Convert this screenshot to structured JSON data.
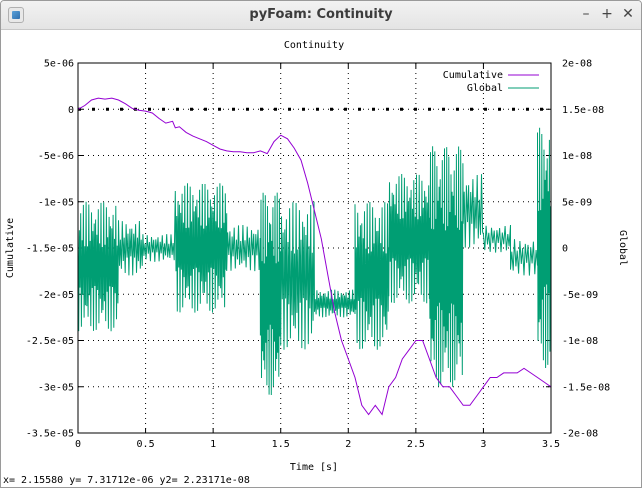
{
  "window": {
    "title": "pyFoam: Continuity",
    "minimize_glyph": "–",
    "maximize_glyph": "+",
    "close_glyph": "✕",
    "app_icon": "plot-app-icon"
  },
  "status_bar": {
    "text": "x= 2.15580 y= 7.31712e-06 y2= 2.23171e-08"
  },
  "chart_data": {
    "type": "line",
    "title": "Continuity",
    "xlabel": "Time [s]",
    "ylabel": "Cumulative",
    "y2label": "Global",
    "xlim": [
      0,
      3.5
    ],
    "ylim": [
      -3.5e-05,
      5e-06
    ],
    "y2lim": [
      -2e-08,
      2e-08
    ],
    "x_ticks": [
      0,
      0.5,
      1,
      1.5,
      2,
      2.5,
      3,
      3.5
    ],
    "x_tick_labels": [
      "0",
      "0.5",
      "1",
      "1.5",
      "2",
      "2.5",
      "3",
      "3.5"
    ],
    "y_ticks": [
      5e-06,
      0,
      -5e-06,
      -1e-05,
      -1.5e-05,
      -2e-05,
      -2.5e-05,
      -3e-05,
      -3.5e-05
    ],
    "y_tick_labels": [
      "5e-06",
      "0",
      "-5e-06",
      "-1e-05",
      "-1.5e-05",
      "-2e-05",
      "-2.5e-05",
      "-3e-05",
      "-3.5e-05"
    ],
    "y2_ticks": [
      2e-08,
      1.5e-08,
      1e-08,
      5e-09,
      0,
      -5e-09,
      -1e-08,
      -1.5e-08,
      -2e-08
    ],
    "y2_tick_labels": [
      "2e-08",
      "1.5e-08",
      "1e-08",
      "5e-09",
      "0",
      "-5e-09",
      "-1e-08",
      "-1.5e-08",
      "-2e-08"
    ],
    "grid": true,
    "legend_position": "top-right",
    "series": [
      {
        "name": "Cumulative",
        "axis": "y1",
        "color": "#9400d3",
        "x": [
          0,
          0.05,
          0.1,
          0.15,
          0.2,
          0.25,
          0.3,
          0.35,
          0.4,
          0.45,
          0.5,
          0.55,
          0.6,
          0.65,
          0.7,
          0.72,
          0.75,
          0.8,
          0.85,
          0.9,
          0.95,
          1.0,
          1.05,
          1.1,
          1.15,
          1.2,
          1.25,
          1.3,
          1.35,
          1.4,
          1.45,
          1.5,
          1.55,
          1.6,
          1.65,
          1.7,
          1.75,
          1.8,
          1.85,
          1.9,
          1.95,
          2.0,
          2.05,
          2.1,
          2.15,
          2.2,
          2.25,
          2.3,
          2.35,
          2.4,
          2.45,
          2.5,
          2.55,
          2.6,
          2.65,
          2.7,
          2.75,
          2.8,
          2.85,
          2.9,
          2.95,
          3.0,
          3.05,
          3.1,
          3.15,
          3.2,
          3.25,
          3.3,
          3.35,
          3.4,
          3.45,
          3.5
        ],
        "y": [
          0.0,
          4e-07,
          1e-06,
          1.2e-06,
          1.1e-06,
          1.2e-06,
          1e-06,
          6e-07,
          1e-07,
          -1e-07,
          -2e-07,
          -4e-07,
          -1e-06,
          -1.5e-06,
          -1.3e-06,
          -2e-06,
          -1.9e-06,
          -2.5e-06,
          -2.9e-06,
          -3.2e-06,
          -3.5e-06,
          -3.9e-06,
          -4.3e-06,
          -4.5e-06,
          -4.6e-06,
          -4.6e-06,
          -4.7e-06,
          -4.7e-06,
          -4.5e-06,
          -4.8e-06,
          -3.5e-06,
          -2.8e-06,
          -3.2e-06,
          -4.2e-06,
          -5.5e-06,
          -8e-06,
          -1.1e-05,
          -1.4e-05,
          -1.8e-05,
          -2.2e-05,
          -2.5e-05,
          -2.7e-05,
          -2.9e-05,
          -3.2e-05,
          -3.3e-05,
          -3.2e-05,
          -3.3e-05,
          -3e-05,
          -2.9e-05,
          -2.7e-05,
          -2.6e-05,
          -2.5e-05,
          -2.5e-05,
          -2.7e-05,
          -2.9e-05,
          -3e-05,
          -3e-05,
          -3.1e-05,
          -3.2e-05,
          -3.2e-05,
          -3.1e-05,
          -3e-05,
          -2.9e-05,
          -2.9e-05,
          -2.85e-05,
          -2.85e-05,
          -2.85e-05,
          -2.8e-05,
          -2.85e-05,
          -2.9e-05,
          -2.95e-05,
          -3e-05
        ]
      },
      {
        "name": "Global",
        "axis": "y2",
        "color": "#009e73",
        "segments": [
          {
            "start": 0.0,
            "end": 0.3,
            "center": -2e-09,
            "amplitude": 7e-09,
            "step": 0.005
          },
          {
            "start": 0.3,
            "end": 0.48,
            "center": 0,
            "amplitude": 3e-09,
            "step": 0.007
          },
          {
            "start": 0.48,
            "end": 0.72,
            "center": 0,
            "amplitude": 1.5e-09,
            "step": 0.008
          },
          {
            "start": 0.72,
            "end": 1.1,
            "center": 0,
            "amplitude": 7e-09,
            "step": 0.005
          },
          {
            "start": 1.1,
            "end": 1.35,
            "center": 0,
            "amplitude": 2.5e-09,
            "step": 0.008
          },
          {
            "start": 1.35,
            "end": 1.5,
            "center": -5e-09,
            "amplitude": 1.1e-08,
            "step": 0.004
          },
          {
            "start": 1.5,
            "end": 1.75,
            "center": -3e-09,
            "amplitude": 8e-09,
            "step": 0.006
          },
          {
            "start": 1.75,
            "end": 2.05,
            "center": -6e-09,
            "amplitude": 1.5e-09,
            "step": 0.006
          },
          {
            "start": 2.05,
            "end": 2.3,
            "center": -3e-09,
            "amplitude": 8e-09,
            "step": 0.005
          },
          {
            "start": 2.3,
            "end": 2.6,
            "center": 1e-09,
            "amplitude": 7e-09,
            "step": 0.005
          },
          {
            "start": 2.6,
            "end": 2.85,
            "center": -2e-09,
            "amplitude": 1.3e-08,
            "step": 0.004
          },
          {
            "start": 2.85,
            "end": 3.0,
            "center": 4e-09,
            "amplitude": 4e-09,
            "step": 0.008
          },
          {
            "start": 3.0,
            "end": 3.2,
            "center": 1e-09,
            "amplitude": 1.5e-09,
            "step": 0.01
          },
          {
            "start": 3.2,
            "end": 3.4,
            "center": -1e-09,
            "amplitude": 2e-09,
            "step": 0.01
          },
          {
            "start": 3.4,
            "end": 3.5,
            "center": 0,
            "amplitude": 1.3e-08,
            "step": 0.004
          }
        ]
      }
    ],
    "reference_line": {
      "y": 0,
      "style": "dotted"
    }
  }
}
